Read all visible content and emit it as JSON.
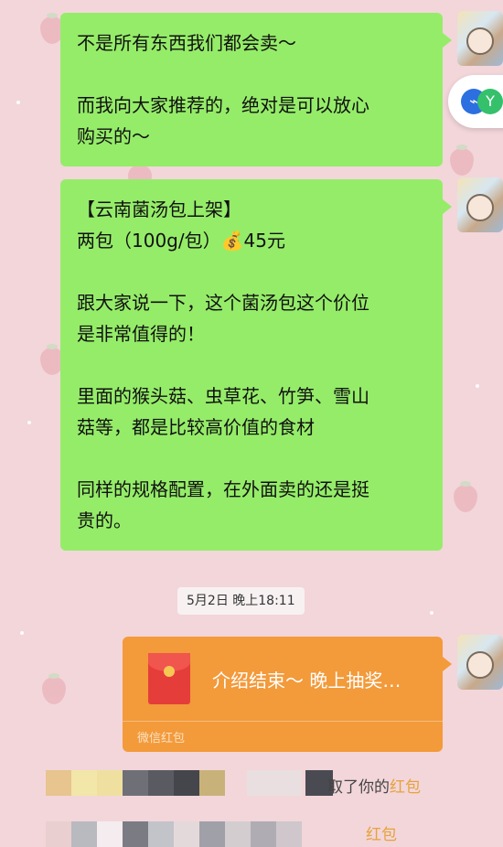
{
  "messages": [
    {
      "lines": [
        "不是所有东西我们都会卖～",
        "",
        "而我向大家推荐的，绝对是可以放心",
        "购买的～"
      ]
    },
    {
      "lines": [
        "【云南菌汤包上架】",
        "两包（100g/包）💰45元",
        "",
        "跟大家说一下，这个菌汤包这个价位",
        "是非常值得的！",
        "",
        "里面的猴头菇、虫草花、竹笋、雪山",
        "菇等，都是比较高价值的食材",
        "",
        "同样的规格配置，在外面卖的还是挺",
        "贵的。"
      ]
    }
  ],
  "timestamp": "5月2日 晚上18:11",
  "red_packet": {
    "title": "介绍结束～ 晚上抽奖…",
    "footer": "微信红包"
  },
  "notices": [
    {
      "text": "取了你的",
      "highlight": "红包"
    },
    {
      "text": "",
      "highlight": "红包"
    }
  ],
  "colors": {
    "bubble": "#95ec69",
    "red_packet": "#f39a3a",
    "background": "#f2d6da"
  }
}
